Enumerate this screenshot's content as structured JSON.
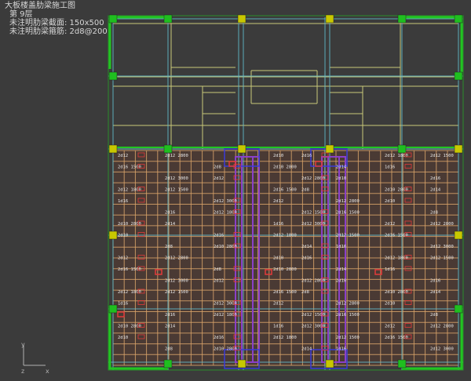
{
  "header": {
    "title": "大板楼盖肋梁施工图",
    "floor": "第 9层",
    "section_note": "未注明肋梁截面: 150x500",
    "rebar_note": "未注明肋梁箍筋: 2d8@200"
  },
  "axes": {
    "y": "y",
    "z": "z",
    "x": "x"
  },
  "colors": {
    "background": "#3b3b3b",
    "wall": "#22c522",
    "axis_line": "#5fb8c8",
    "beam_line": "#c8c87a",
    "rib_grid": "#d9a36a",
    "rebar_label": "#e8e8e8",
    "red_mark": "#e23a3a",
    "column_yellow": "#c8c800",
    "column_green": "#1fbf1f",
    "core_blue": "#3a3ad8",
    "core_purple": "#8a40c8"
  },
  "rebar_labels": [
    "2d12",
    "2d12 2800",
    "2d10",
    "2d16",
    "2d12 1800",
    "2d12 1500",
    "2d16 1500",
    "2d8",
    "2d10 2800",
    "2d14",
    "1d16",
    "2d12 3000"
  ]
}
